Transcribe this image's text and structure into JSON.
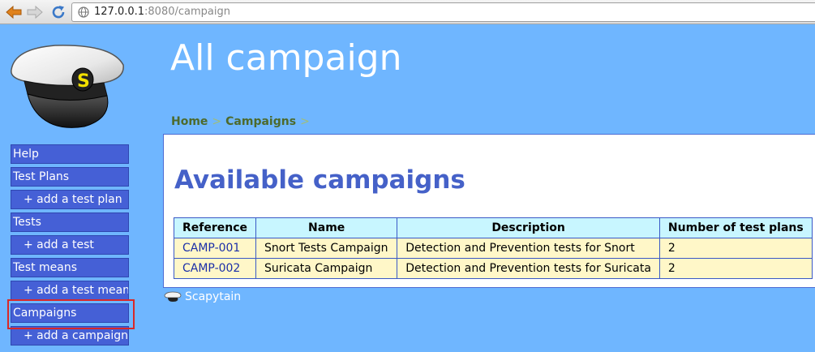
{
  "browser": {
    "url_host": "127.0.0.1",
    "url_rest": ":8080/campaign"
  },
  "sidebar": {
    "items": [
      {
        "label": "Help",
        "sub": false
      },
      {
        "label": "Test Plans",
        "sub": false
      },
      {
        "label": "+ add a test plan",
        "sub": true
      },
      {
        "label": "Tests",
        "sub": false
      },
      {
        "label": "+ add a test",
        "sub": true
      },
      {
        "label": "Test means",
        "sub": false
      },
      {
        "label": "+ add a test mean",
        "sub": true
      },
      {
        "label": "Campaigns",
        "sub": false
      },
      {
        "label": "+ add a campaign",
        "sub": true
      }
    ]
  },
  "header": {
    "title": "All campaign"
  },
  "breadcrumb": {
    "home": "Home",
    "current": "Campaigns",
    "separator": ">"
  },
  "main": {
    "section_title": "Available campaigns",
    "table": {
      "columns": [
        "Reference",
        "Name",
        "Description",
        "Number of test plans"
      ],
      "rows": [
        [
          "CAMP-001",
          "Snort Tests Campaign",
          "Detection and Prevention tests for Snort",
          "2"
        ],
        [
          "CAMP-002",
          "Suricata Campaign",
          "Detection and Prevention tests for Suricata",
          "2"
        ]
      ]
    }
  },
  "footer": {
    "label": "Scapytain"
  },
  "colors": {
    "page_bg": "#6fb6ff",
    "menu_bg": "#4560d6",
    "header_cell_bg": "#c8f6ff",
    "row_bg": "#fff7c8",
    "highlight": "#d92828"
  }
}
